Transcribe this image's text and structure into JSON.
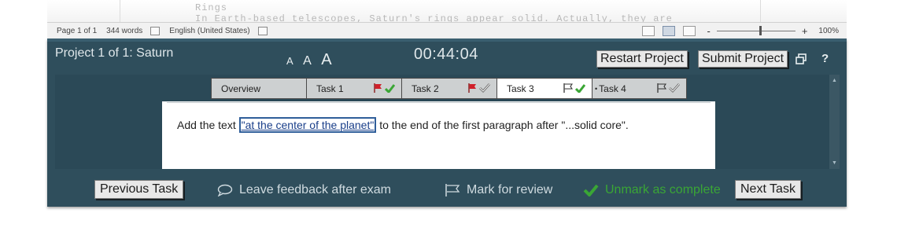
{
  "document": {
    "ghost_line_1": "Rings",
    "ghost_line_2": "In Earth-based telescopes, Saturn's rings appear solid. Actually, they are"
  },
  "statusbar": {
    "page": "Page 1 of 1",
    "words": "344 words",
    "proofing_icon": "proofing-icon",
    "language": "English (United States)",
    "macro_icon": "macro-recording-icon",
    "view_icons": [
      "read-mode-icon",
      "print-layout-icon",
      "web-layout-icon"
    ],
    "zoom_minus": "-",
    "zoom_plus": "+",
    "zoom": "100%",
    "zoom_level": 100
  },
  "exam": {
    "project_title": "Project 1 of 1: Saturn",
    "font_small": "A",
    "font_medium": "A",
    "font_large": "A",
    "timer": "00:44:04",
    "restart_label": "Restart Project",
    "submit_label": "Submit Project",
    "help_label": "?",
    "tabs": [
      {
        "label": "Overview",
        "flagged": false,
        "complete": false,
        "active": false
      },
      {
        "label": "Task 1",
        "flagged": true,
        "complete": true,
        "active": false
      },
      {
        "label": "Task 2",
        "flagged": true,
        "complete": false,
        "active": false
      },
      {
        "label": "Task 3",
        "flagged": false,
        "complete": true,
        "active": true
      },
      {
        "label": "Task 4",
        "flagged": false,
        "complete": false,
        "active": false,
        "current_marker": "•"
      }
    ],
    "task": {
      "prefix": "Add the text ",
      "highlight": "\"at the center of the planet\"",
      "suffix": " to the end of the first paragraph after \"...solid core\"."
    },
    "footer": {
      "previous_label": "Previous Task",
      "feedback_label": "Leave feedback after exam",
      "review_label": "Mark for review",
      "complete_label": "Unmark as complete",
      "next_label": "Next Task"
    },
    "colors": {
      "panel": "#2f4e5c",
      "flag_red": "#d0202a",
      "check_green": "#3aa635"
    }
  }
}
